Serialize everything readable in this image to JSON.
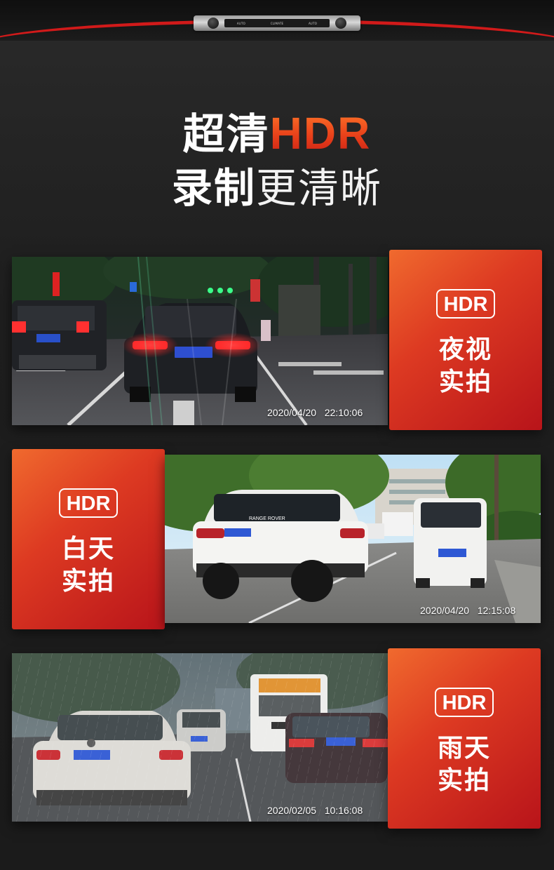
{
  "header": {
    "dash_labels": [
      "AUTO",
      "CLIMATE",
      "AUTO"
    ]
  },
  "headline": {
    "line1_prefix": "超清",
    "line1_hdr": "HDR",
    "line2_bold": "录制",
    "line2_thin": "更清晰"
  },
  "panels": [
    {
      "badge": "HDR",
      "title_line1": "夜视",
      "title_line2": "实拍",
      "timestamp": "2020/04/20   22:10:06",
      "plate_main": "粤B·V000M",
      "plate_side": "粤L 2BE5H"
    },
    {
      "badge": "HDR",
      "title_line1": "白天",
      "title_line2": "实拍",
      "timestamp": "2020/04/20   12:15:08",
      "plate_main": "粤B 6UC4A",
      "plate_side": "粤B 10E49",
      "brand": "RANGE ROVER"
    },
    {
      "badge": "HDR",
      "title_line1": "雨天",
      "title_line2": "实拍",
      "timestamp": "2020/02/05   10:16:08",
      "plate_main": "粤B 21372",
      "plate_side": "粤B 4HN56",
      "bus_plate": "粤B 4528?0"
    }
  ],
  "colors": {
    "accent_red": "#d11a1a",
    "card_gradient_start": "#f06a2e",
    "card_gradient_end": "#b8141a",
    "background": "#1f1f1f"
  }
}
